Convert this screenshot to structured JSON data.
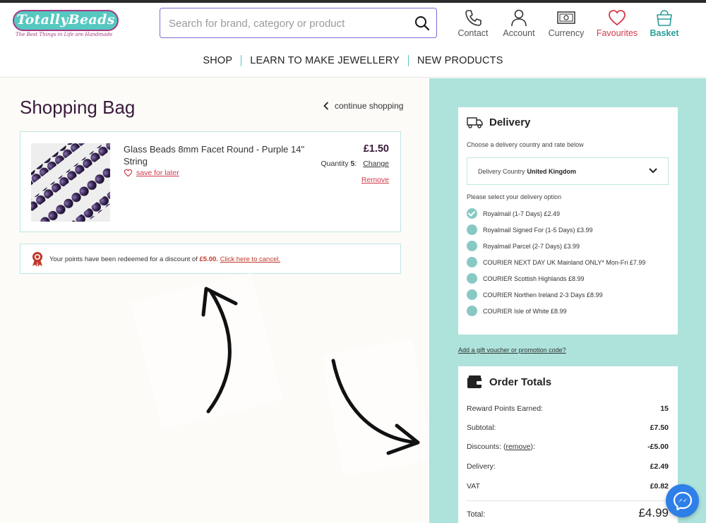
{
  "logo": {
    "text": "TotallyBeads",
    "tagline": "The Best Things in Life are Handmade"
  },
  "search": {
    "placeholder": "Search for brand, category or product"
  },
  "header_nav": [
    {
      "label": "Contact",
      "icon": "phone-icon"
    },
    {
      "label": "Account",
      "icon": "user-icon"
    },
    {
      "label": "Currency",
      "icon": "banknote-icon"
    },
    {
      "label": "Favourites",
      "icon": "heart-icon"
    },
    {
      "label": "Basket",
      "icon": "basket-icon"
    }
  ],
  "main_nav": [
    "SHOP",
    "LEARN TO MAKE JEWELLERY",
    "NEW PRODUCTS"
  ],
  "bag": {
    "title": "Shopping Bag",
    "continue_label": "continue shopping",
    "item": {
      "name": "Glass Beads 8mm Facet Round - Purple 14\" String",
      "save_label": "save for later",
      "price": "£1.50",
      "quantity_label": "Quantity",
      "quantity_value": "5",
      "change_label": "Change",
      "remove_label": "Remove"
    },
    "points": {
      "text_before": "Your points have been redeemed for a discount of",
      "amount": "£5.00.",
      "cancel_label": "Click here to cancel."
    }
  },
  "delivery": {
    "title": "Delivery",
    "subtitle": "Choose a delivery country and rate below",
    "country_label": "Delivery Country",
    "country_value": "United Kingdom",
    "options_title": "Please select your delivery option",
    "options": [
      {
        "label": "Royalmail (1-7 Days) £2.49",
        "selected": true
      },
      {
        "label": "Royalmail Signed For (1-5 Days) £3.99",
        "selected": false
      },
      {
        "label": "Royalmail Parcel (2-7 Days) £3.99",
        "selected": false
      },
      {
        "label": "COURIER NEXT DAY UK Mainland ONLY* Mon-Fri £7.99",
        "selected": false
      },
      {
        "label": "COURIER Scottish Highlands £8.99",
        "selected": false
      },
      {
        "label": "COURIER Northen Ireland 2-3 Days £8.99",
        "selected": false
      },
      {
        "label": "COURIER Isle of White £8.99",
        "selected": false
      }
    ]
  },
  "gift_link": "Add a gift voucher or promotion code?",
  "totals": {
    "title": "Order Totals",
    "reward_label": "Reward Points Earned:",
    "reward_value": "15",
    "subtotal_label": "Subtotal:",
    "subtotal_value": "£7.50",
    "discounts_label": "Discounts:",
    "discounts_remove": "remove",
    "discounts_value": "-£5.00",
    "delivery_label": "Delivery:",
    "delivery_value": "£2.49",
    "vat_label": "VAT",
    "vat_value": "£0.82",
    "total_label": "Total:",
    "total_value": "£4.99"
  },
  "colors": {
    "accent": "#55c8c0",
    "sidebar_bg": "#ade3db",
    "brand_purple": "#a53b82",
    "alert_red": "#d23a4a"
  }
}
